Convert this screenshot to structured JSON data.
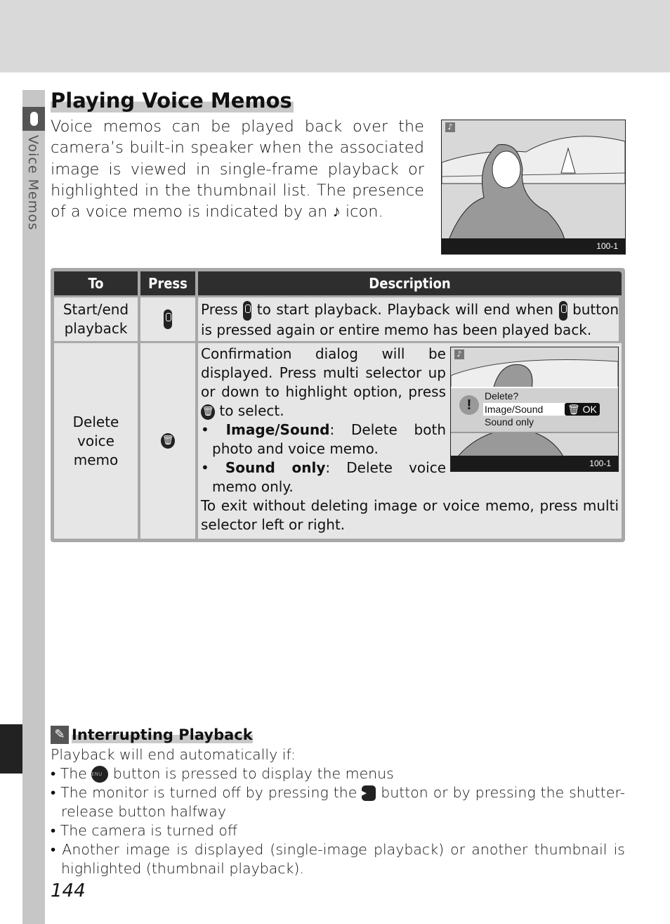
{
  "section_tab": {
    "label": "Voice Memos",
    "icon": "microphone-icon"
  },
  "title": "Playing Voice Memos",
  "intro": "Voice memos can be played back over the camera’s built-in speaker when the associated image is viewed in single-frame playback or highlighted in the thumbnail list.  The presence of a voice memo is indicated by an",
  "intro_end": "icon.",
  "photo1": {
    "frame": "100-1",
    "icon": "voice-memo-note-icon"
  },
  "table": {
    "headers": [
      "To",
      "Press",
      "Description"
    ],
    "rows": [
      {
        "to": "Start/end playback",
        "press_icon": "microphone-button-icon",
        "desc_parts": [
          "Press",
          "to start playback.  Playback will end when",
          "button is pressed again or entire memo has been played back."
        ]
      },
      {
        "to": "Delete voice memo",
        "press_icon": "trash-button-icon",
        "desc_intro_a": "Confirmation dialog will be displayed.  Press multi selector up or down to highlight option, press",
        "desc_intro_b": "to select.",
        "options": [
          {
            "name": "Image/Sound",
            "text": ": Delete both photo and voice memo."
          },
          {
            "name": "Sound only",
            "text": ": Delete voice memo only."
          }
        ],
        "desc_outro": "To exit without deleting image or voice memo, press multi selector left or right."
      }
    ]
  },
  "dialog": {
    "title": "Delete?",
    "options": [
      "Image/Sound",
      "Sound only"
    ],
    "selected": "Image/Sound",
    "ok": "OK",
    "frame": "100-1"
  },
  "note": {
    "title": "Interrupting Playback",
    "intro": "Playback will end automatically if:",
    "b1a": "The",
    "b1_btn": "MENU",
    "b1b": "button is pressed to display the menus",
    "b2a": "The monitor is turned off by pressing the",
    "b2b": "button or by pressing the shutter-release button halfway",
    "b3": "The camera is turned off",
    "b4": "Another image is displayed (single-image playback) or another thumbnail is highlighted (thumbnail playback)."
  },
  "page_number": "144"
}
